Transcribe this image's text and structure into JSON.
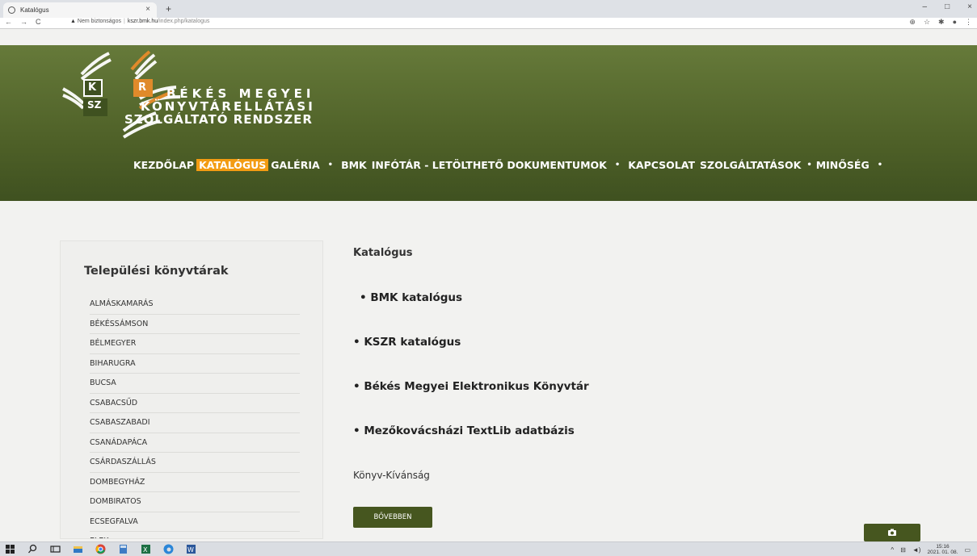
{
  "browser": {
    "tab_title": "Katalógus",
    "tab_close": "×",
    "new_tab": "+",
    "url_warning": "Nem biztonságos",
    "url_domain": "kszr.bmk.hu",
    "url_path": "/index.php/katalogus",
    "nav_back": "←",
    "nav_forward": "→",
    "nav_reload": "C",
    "window_min": "–",
    "window_max": "□",
    "window_close": "×"
  },
  "logo": {
    "line1": "BÉKÉS MEGYEI",
    "line2": "KÖNYVTÁRELLÁTÁSI",
    "line3": "SZOLGÁLTATÓ RENDSZER",
    "letter_k": "K",
    "letter_r": "R",
    "letter_sz": "SZ"
  },
  "nav": {
    "items": [
      {
        "label": "KEZDŐLAP"
      },
      {
        "label": "KATALÓGUS"
      },
      {
        "label": "GALÉRIA"
      },
      {
        "label": "BMK"
      },
      {
        "label": "INFÓTÁR - LETÖLTHETŐ DOKUMENTUMOK"
      },
      {
        "label": "KAPCSOLAT"
      },
      {
        "label": "SZOLGÁLTATÁSOK"
      },
      {
        "label": "MINŐSÉG"
      }
    ],
    "dot": "•",
    "active_color": "#f39c12",
    "header_color": "#4f6128"
  },
  "sidebar": {
    "title": "Települési könyvtárak",
    "items": [
      "ALMÁSKAMARÁS",
      "BÉKÉSSÁMSON",
      "BÉLMEGYER",
      "BIHARUGRA",
      "BUCSA",
      "CSABACSŰD",
      "CSABASZABADI",
      "CSANÁDAPÁCA",
      "CSÁRDASZÁLLÁS",
      "DOMBEGYHÁZ",
      "DOMBIRATOS",
      "ECSEGFALVA",
      "ELEK"
    ]
  },
  "main": {
    "title": "Katalógus",
    "links": [
      "• BMK katalógus",
      "• KSZR katalógus",
      "• Békés Megyei Elektronikus Könyvtár",
      "• Mezőkovácsházi TextLib adatbázis"
    ],
    "book_wish": "Könyv-Kívánság",
    "more_button": "BŐVEBBEN"
  },
  "taskbar": {
    "time": "15:16",
    "date": "2021. 01. 08."
  }
}
